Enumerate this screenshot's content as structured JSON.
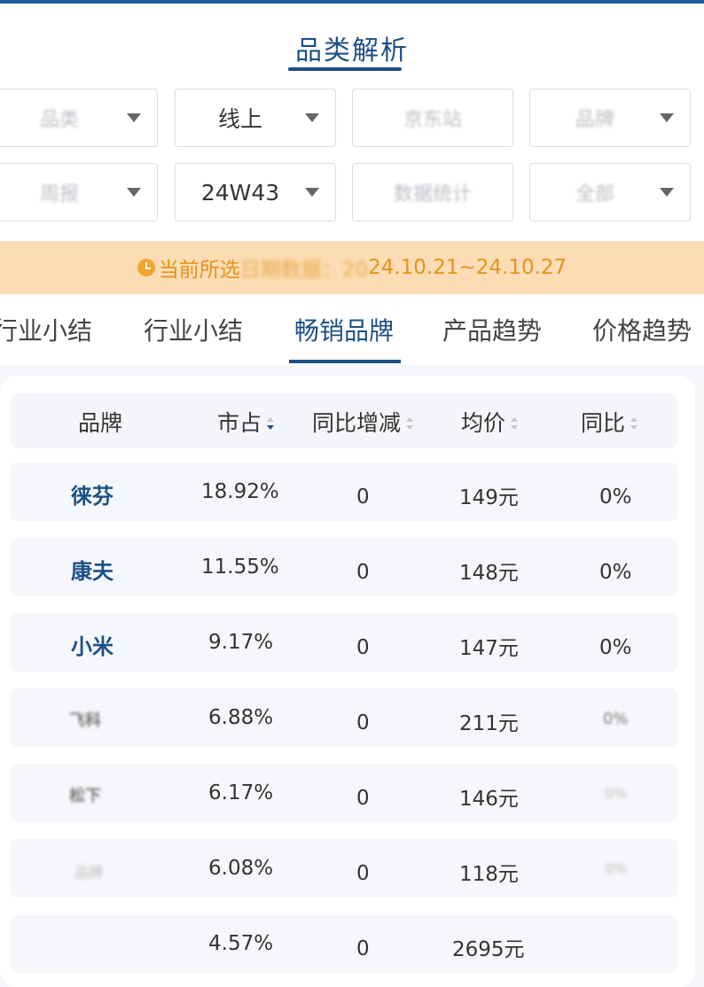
{
  "header": {
    "title": "品类解析"
  },
  "filters": [
    {
      "label": "品类",
      "blurred": true,
      "has_caret": true
    },
    {
      "label": "线上",
      "blurred": false,
      "has_caret": true
    },
    {
      "label": "京东站",
      "blurred": true,
      "has_caret": false
    },
    {
      "label": "品牌",
      "blurred": true,
      "has_caret": true
    },
    {
      "label": "周报",
      "blurred": true,
      "has_caret": true
    },
    {
      "label": "24W43",
      "blurred": false,
      "has_caret": true
    },
    {
      "label": "数据统计",
      "blurred": true,
      "has_caret": false
    },
    {
      "label": "全部",
      "blurred": true,
      "has_caret": true
    }
  ],
  "banner": {
    "prefix": "当前所选",
    "blurred_part": "日期数据：20",
    "range": "24.10.21~24.10.27"
  },
  "tabs": [
    {
      "label": "行业小结",
      "active": false
    },
    {
      "label": "行业小结",
      "active": false
    },
    {
      "label": "畅销品牌",
      "active": true
    },
    {
      "label": "产品趋势",
      "active": false
    },
    {
      "label": "价格趋势",
      "active": false
    }
  ],
  "table": {
    "columns": [
      "品牌",
      "市占",
      "同比增减",
      "均价",
      "同比"
    ],
    "rows": [
      {
        "brand": "徕芬",
        "share": "18.92%",
        "change": "0",
        "price": "149元",
        "yoy": "0%"
      },
      {
        "brand": "康夫",
        "share": "11.55%",
        "change": "0",
        "price": "148元",
        "yoy": "0%"
      },
      {
        "brand": "小米",
        "share": "9.17%",
        "change": "0",
        "price": "147元",
        "yoy": "0%"
      },
      {
        "brand": "飞科",
        "share": "6.88%",
        "change": "0",
        "price": "211元",
        "yoy": "0%"
      },
      {
        "brand": "松下",
        "share": "6.17%",
        "change": "0",
        "price": "146元",
        "yoy": "0%"
      },
      {
        "brand": "品牌",
        "share": "6.08%",
        "change": "0",
        "price": "118元",
        "yoy": "0%"
      },
      {
        "brand": "",
        "share": "4.57%",
        "change": "0",
        "price": "2695元",
        "yoy": ""
      }
    ]
  }
}
